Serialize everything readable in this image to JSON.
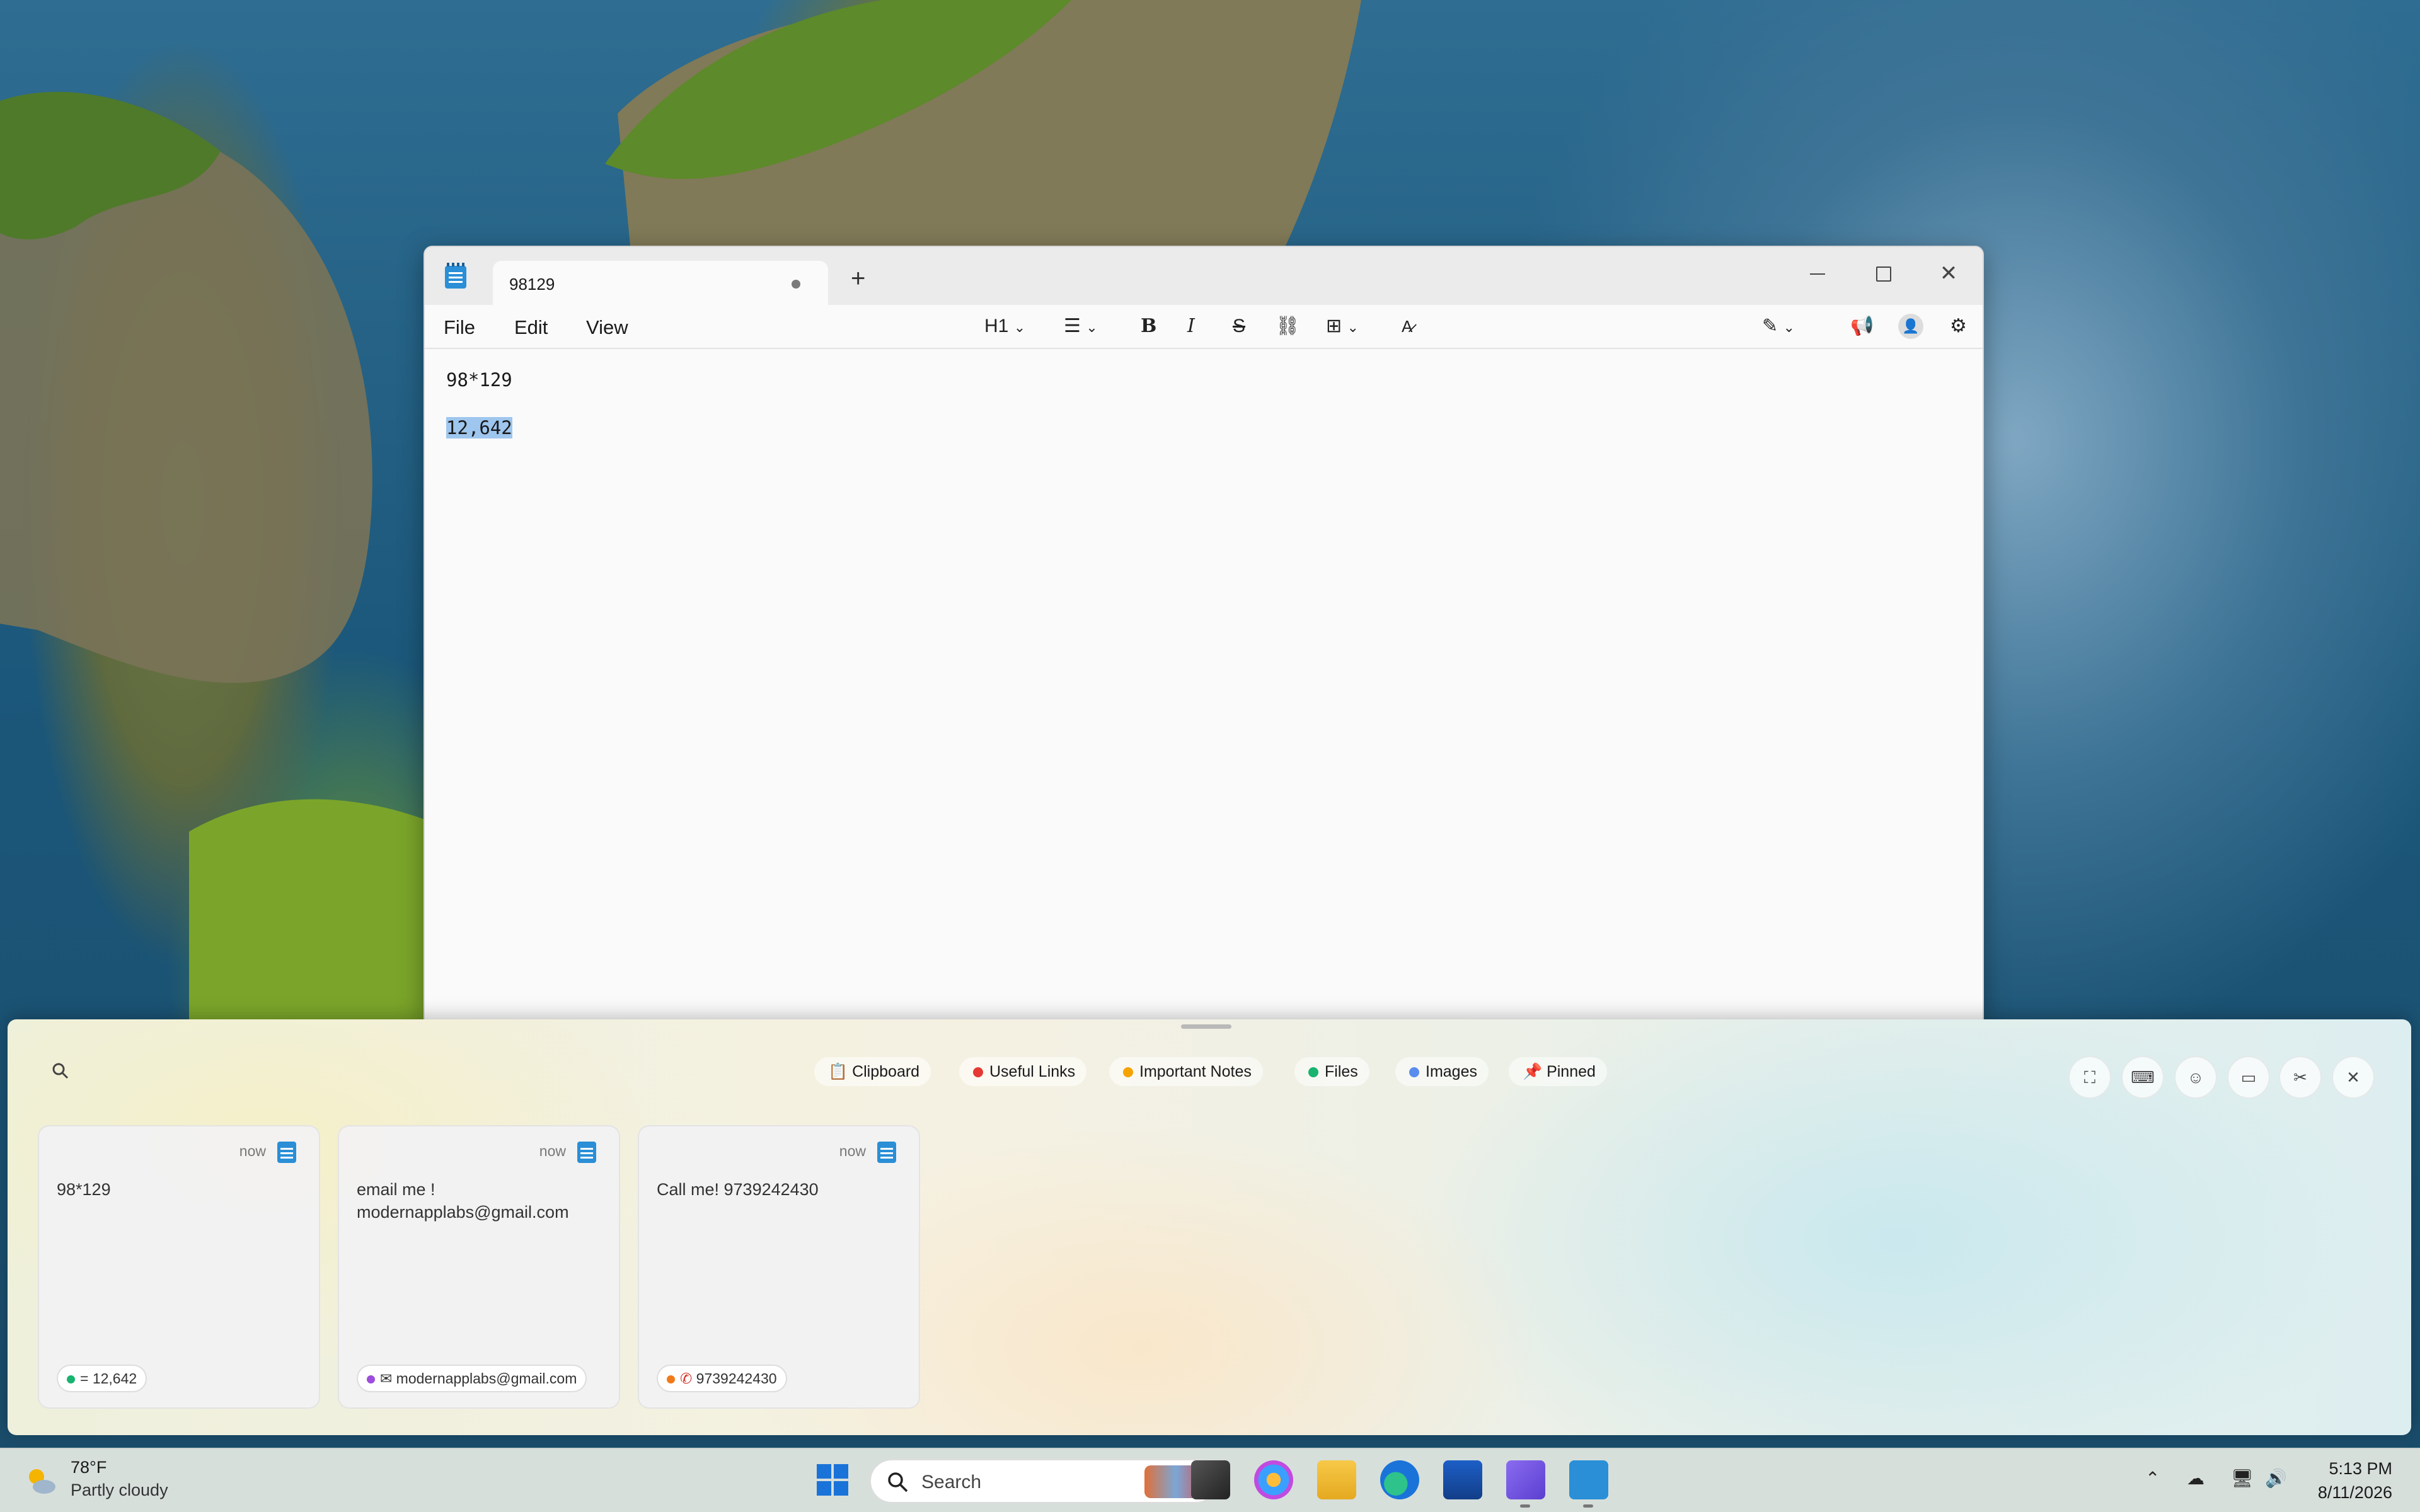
{
  "notepad": {
    "tab_title": "98129",
    "menus": [
      "File",
      "Edit",
      "View"
    ],
    "heading_style": "H1",
    "lines": [
      "98*129",
      "12,642"
    ]
  },
  "clipboard": {
    "categories": [
      {
        "label": "Clipboard",
        "color": ""
      },
      {
        "label": "Useful Links",
        "color": "#e53935"
      },
      {
        "label": "Important Notes",
        "color": "#f5a300"
      },
      {
        "label": "Files",
        "color": "#19b370"
      },
      {
        "label": "Images",
        "color": "#5b8def"
      },
      {
        "label": "Pinned",
        "color": ""
      }
    ],
    "cards": [
      {
        "time": "now",
        "text": "98*129",
        "pill": "= 12,642",
        "pill_color": "#19b370"
      },
      {
        "time": "now",
        "text": "email me !\nmodernapplabs@gmail.com",
        "pill": "modernapplabs@gmail.com",
        "pill_color": "#9c4ddb"
      },
      {
        "time": "now",
        "text": "Call me! 9739242430",
        "pill": "9739242430",
        "pill_color": "#f07a1a"
      }
    ]
  },
  "taskbar": {
    "weather_temp": "78°F",
    "weather_desc": "Partly cloudy",
    "search_label": "Search",
    "time": "5:13 PM",
    "date": "8/11/2026"
  }
}
